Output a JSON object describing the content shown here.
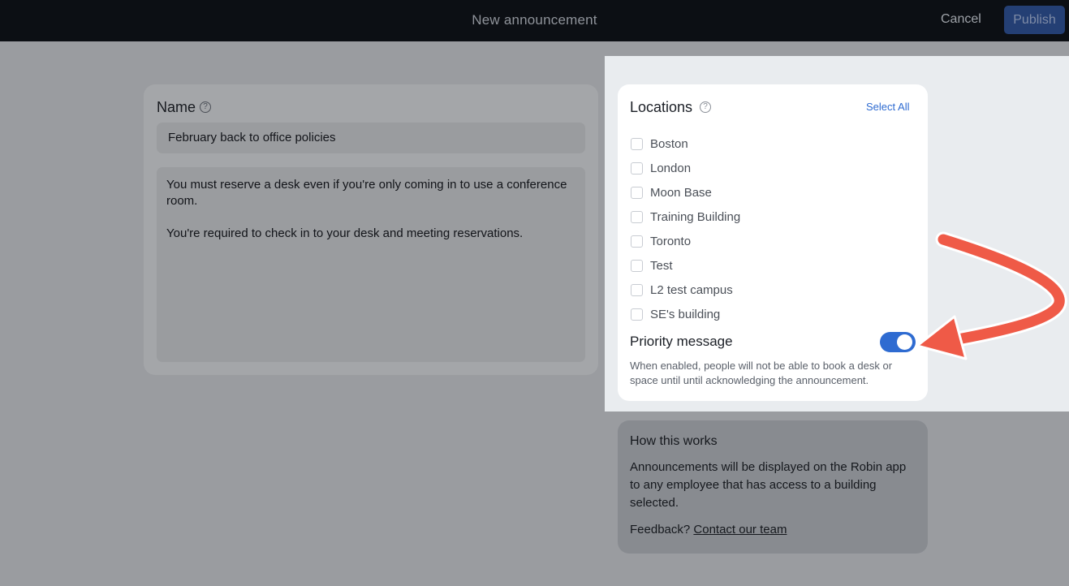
{
  "header": {
    "title": "New announcement",
    "cancel_label": "Cancel",
    "publish_label": "Publish"
  },
  "name_section": {
    "label": "Name",
    "help_icon": "?",
    "name_value": "February back to office policies",
    "body_paragraphs": [
      "You must reserve a desk even if you're only coming in to use a conference room.",
      "You're required to check in to your desk and meeting reservations."
    ]
  },
  "locations": {
    "title": "Locations",
    "help_icon": "?",
    "select_all_label": "Select All",
    "items": [
      {
        "label": "Boston",
        "checked": false
      },
      {
        "label": "London",
        "checked": false
      },
      {
        "label": "Moon Base",
        "checked": false
      },
      {
        "label": "Training Building",
        "checked": false
      },
      {
        "label": "Toronto",
        "checked": false
      },
      {
        "label": "Test",
        "checked": false
      },
      {
        "label": "L2 test campus",
        "checked": false
      },
      {
        "label": "SE's building",
        "checked": false
      }
    ],
    "priority": {
      "label": "Priority message",
      "enabled": true,
      "help": "When enabled, people will not be able to book a desk or space until until acknowledging the announcement."
    }
  },
  "how_it_works": {
    "title": "How this works",
    "body": "Announcements will be displayed on the Robin app to any employee that has access to a building selected.",
    "feedback_prefix": "Feedback?",
    "feedback_link": "Contact our team"
  },
  "colors": {
    "accent": "#2e6bd1",
    "annotation_arrow": "#ef5a47",
    "topbar": "#0c0f14"
  }
}
